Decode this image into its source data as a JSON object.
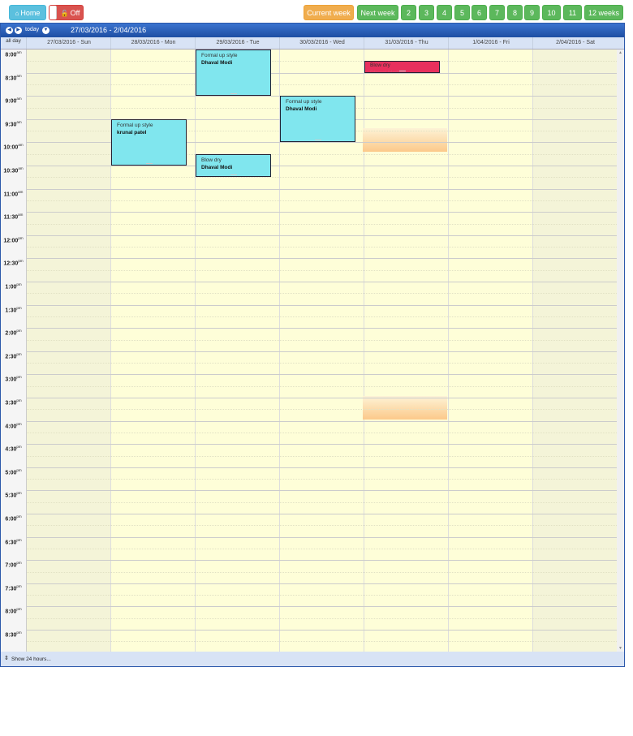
{
  "toolbar": {
    "home_label": "Home",
    "home_icon": "home-icon",
    "off_label": "Off",
    "lock_icon": "unlock-icon",
    "current_week_label": "Current week",
    "next_week_label": "Next week",
    "week_buttons": [
      "2",
      "3",
      "4",
      "5",
      "6",
      "7",
      "8",
      "9",
      "10",
      "11",
      "12 weeks"
    ]
  },
  "calendar": {
    "today_label": "today",
    "range_label": "27/03/2016 - 2/04/2016",
    "allday_label": "all day",
    "days": [
      "27/03/2016 - Sun",
      "28/03/2016 - Mon",
      "29/03/2016 - Tue",
      "30/03/2016 - Wed",
      "31/03/2016 - Thu",
      "1/04/2016 - Fri",
      "2/04/2016 - Sat"
    ],
    "times": [
      {
        "t": "8:00",
        "s": "am"
      },
      {
        "t": "8:30",
        "s": "am"
      },
      {
        "t": "9:00",
        "s": "am"
      },
      {
        "t": "9:30",
        "s": "am"
      },
      {
        "t": "10:00",
        "s": "am"
      },
      {
        "t": "10:30",
        "s": "am"
      },
      {
        "t": "11:00",
        "s": "am"
      },
      {
        "t": "11:30",
        "s": "am"
      },
      {
        "t": "12:00",
        "s": "pm"
      },
      {
        "t": "12:30",
        "s": "pm"
      },
      {
        "t": "1:00",
        "s": "pm"
      },
      {
        "t": "1:30",
        "s": "pm"
      },
      {
        "t": "2:00",
        "s": "pm"
      },
      {
        "t": "2:30",
        "s": "pm"
      },
      {
        "t": "3:00",
        "s": "pm"
      },
      {
        "t": "3:30",
        "s": "pm"
      },
      {
        "t": "4:00",
        "s": "pm"
      },
      {
        "t": "4:30",
        "s": "pm"
      },
      {
        "t": "5:00",
        "s": "pm"
      },
      {
        "t": "5:30",
        "s": "pm"
      },
      {
        "t": "6:00",
        "s": "pm"
      },
      {
        "t": "6:30",
        "s": "pm"
      },
      {
        "t": "7:00",
        "s": "pm"
      },
      {
        "t": "7:30",
        "s": "pm"
      },
      {
        "t": "8:00",
        "s": "pm"
      },
      {
        "t": "8:30",
        "s": "pm"
      }
    ],
    "events": [
      {
        "day": "29/03/2016 - Tue",
        "start": "8:00am",
        "end": "9:00am",
        "title": "Formal up style",
        "client": "Dhaval Modi",
        "color": "#80e6ee"
      },
      {
        "day": "31/03/2016 - Thu",
        "start": "8:15am",
        "end": "8:30am",
        "title": "Blow dry",
        "client": "Dhaval Modi",
        "color": "#e8305d"
      },
      {
        "day": "30/03/2016 - Wed",
        "start": "9:00am",
        "end": "10:00am",
        "title": "Formal up style",
        "client": "Dhaval Modi",
        "color": "#80e6ee"
      },
      {
        "day": "28/03/2016 - Mon",
        "start": "9:30am",
        "end": "10:30am",
        "title": "Formal up style",
        "client": "krunal patel",
        "color": "#80e6ee"
      },
      {
        "day": "29/03/2016 - Tue",
        "start": "10:15am",
        "end": "10:45am",
        "title": "Blow dry",
        "client": "Dhaval Modi",
        "color": "#80e6ee"
      }
    ],
    "footer_label": "Show 24 hours...",
    "footer_icon": "expand-icon"
  }
}
